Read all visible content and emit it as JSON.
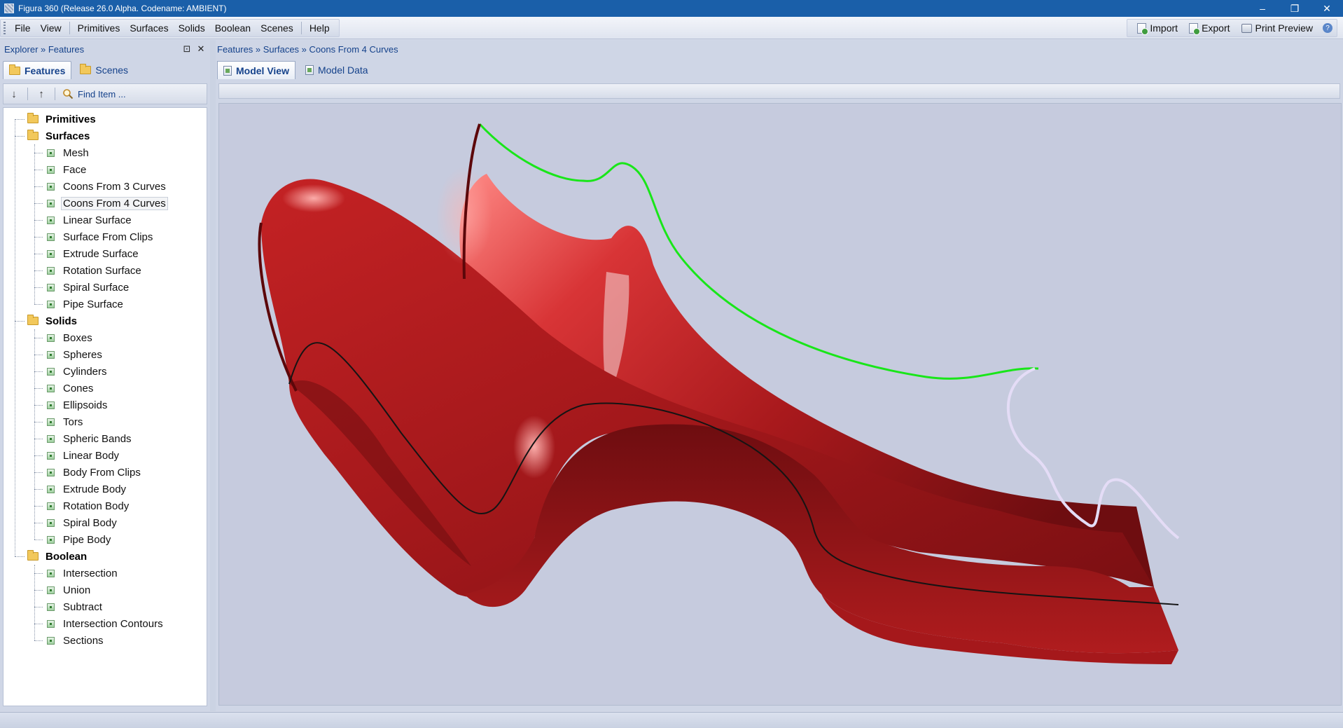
{
  "window": {
    "title": "Figura 360 (Release 26.0 Alpha. Codename: AMBIENT)",
    "minimize": "–",
    "restore": "❐",
    "close": "✕"
  },
  "menu": {
    "items": [
      "File",
      "View",
      "Primitives",
      "Surfaces",
      "Solids",
      "Boolean",
      "Scenes",
      "Help"
    ]
  },
  "toolbar": {
    "import_label": "Import",
    "export_label": "Export",
    "print_preview_label": "Print Preview",
    "help_glyph": "?"
  },
  "explorer": {
    "header": "Explorer » Features",
    "pin_glyph": "⊡",
    "close_glyph": "✕",
    "tabs": [
      "Features",
      "Scenes"
    ],
    "find_label": "Find Item ...",
    "down_glyph": "↓",
    "up_glyph": "↑"
  },
  "tree": {
    "groups": [
      {
        "label": "Primitives",
        "items": []
      },
      {
        "label": "Surfaces",
        "items": [
          "Mesh",
          "Face",
          "Coons From 3 Curves",
          "Coons From 4 Curves",
          "Linear Surface",
          "Surface From Clips",
          "Extrude Surface",
          "Rotation Surface",
          "Spiral Surface",
          "Pipe Surface"
        ]
      },
      {
        "label": "Solids",
        "items": [
          "Boxes",
          "Spheres",
          "Cylinders",
          "Cones",
          "Ellipsoids",
          "Tors",
          "Spheric Bands",
          "Linear Body",
          "Body From Clips",
          "Extrude Body",
          "Rotation Body",
          "Spiral Body",
          "Pipe Body"
        ]
      },
      {
        "label": "Boolean",
        "items": [
          "Intersection",
          "Union",
          "Subtract",
          "Intersection Contours",
          "Sections"
        ]
      }
    ],
    "selected": "Coons From 4 Curves"
  },
  "main": {
    "breadcrumb": "Features » Surfaces » Coons From 4 Curves",
    "tabs": [
      "Model View",
      "Model Data"
    ]
  },
  "colors": {
    "surface_red": "#b01c1e",
    "surface_dark": "#6e0d10",
    "surface_highlight": "#ff7a78",
    "curve_green": "#19e619",
    "curve_lavender": "#e4dcf6",
    "viewport_bg": "#c6cbde",
    "accent": "#1a5fa9"
  }
}
